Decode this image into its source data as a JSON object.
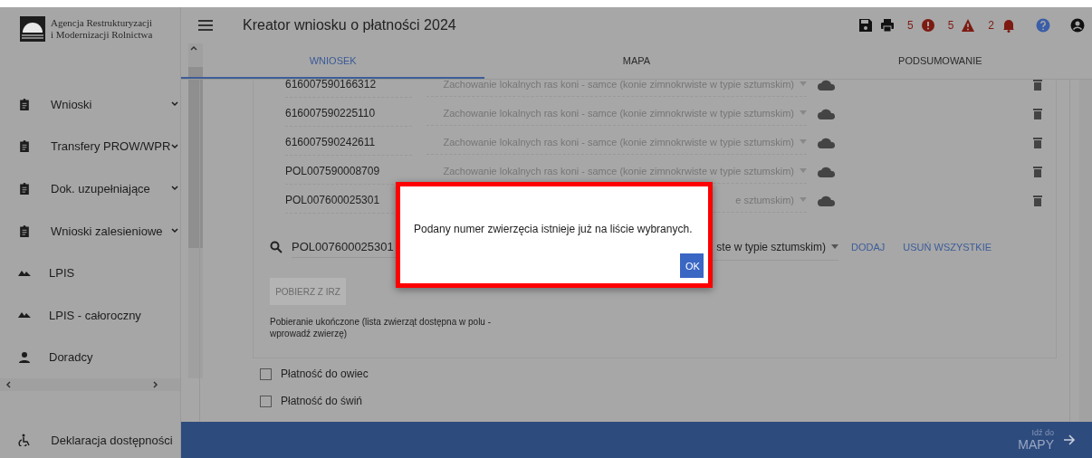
{
  "sidebar": {
    "org_name": [
      "Agencja Restrukturyzacji",
      "i Modernizacji Rolnictwa"
    ],
    "items": [
      {
        "label": "Wnioski",
        "kind": "clipboard",
        "expandable": true
      },
      {
        "label": "Transfery PROW/WPR",
        "kind": "clipboard",
        "expandable": true
      },
      {
        "label": "Dok. uzupełniające",
        "kind": "clipboard",
        "expandable": true
      },
      {
        "label": "Wnioski zalesieniowe",
        "kind": "clipboard",
        "expandable": true
      },
      {
        "label": "LPIS",
        "kind": "terrain",
        "expandable": false
      },
      {
        "label": "LPIS - całoroczny",
        "kind": "terrain",
        "expandable": false
      },
      {
        "label": "Doradcy",
        "kind": "person",
        "expandable": false
      }
    ],
    "footer_item": {
      "label": "Deklaracja dostępności"
    }
  },
  "header": {
    "title": "Kreator wniosku o płatności 2024",
    "badges": [
      {
        "kind": "error",
        "count": "5"
      },
      {
        "kind": "warning",
        "count": "5"
      },
      {
        "kind": "notification",
        "count": "2"
      }
    ]
  },
  "tabs": [
    {
      "label": "WNIOSEK",
      "selected": true
    },
    {
      "label": "MAPA",
      "selected": false
    },
    {
      "label": "PODSUMOWANIE",
      "selected": false
    }
  ],
  "animals": [
    {
      "number": "616007590166312",
      "breed": "Zachowanie lokalnych ras koni - samce (konie zimnokrwiste w typie sztumskim)"
    },
    {
      "number": "616007590225110",
      "breed": "Zachowanie lokalnych ras koni - samce (konie zimnokrwiste w typie sztumskim)"
    },
    {
      "number": "616007590242611",
      "breed": "Zachowanie lokalnych ras koni - samce (konie zimnokrwiste w typie sztumskim)"
    },
    {
      "number": "POL007590008709",
      "breed": "Zachowanie lokalnych ras koni - samce (konie zimnokrwiste w typie sztumskim)"
    },
    {
      "number": "POL007600025301",
      "breed": "e sztumskim)"
    }
  ],
  "search": {
    "value": "POL007600025301",
    "breed": "ste w typie sztumskim)"
  },
  "actions": [
    "DODAJ",
    "USUŃ WSZYSTKIE"
  ],
  "fetch_button": {
    "label": "POBIERZ Z IRZ",
    "disabled": true
  },
  "fetch_status": "Pobieranie ukończone (lista zwierząt dostępna w polu - wprowadź zwierzę)",
  "payments": [
    {
      "label": "Płatność do owiec",
      "checked": false
    },
    {
      "label": "Płatność do świń",
      "checked": false
    }
  ],
  "dialog": {
    "message": "Podany numer zwierzęcia istnieje już na liście wybranych.",
    "button": "OK"
  },
  "next_step": {
    "caption": "Idź do",
    "target": "MAPY"
  }
}
